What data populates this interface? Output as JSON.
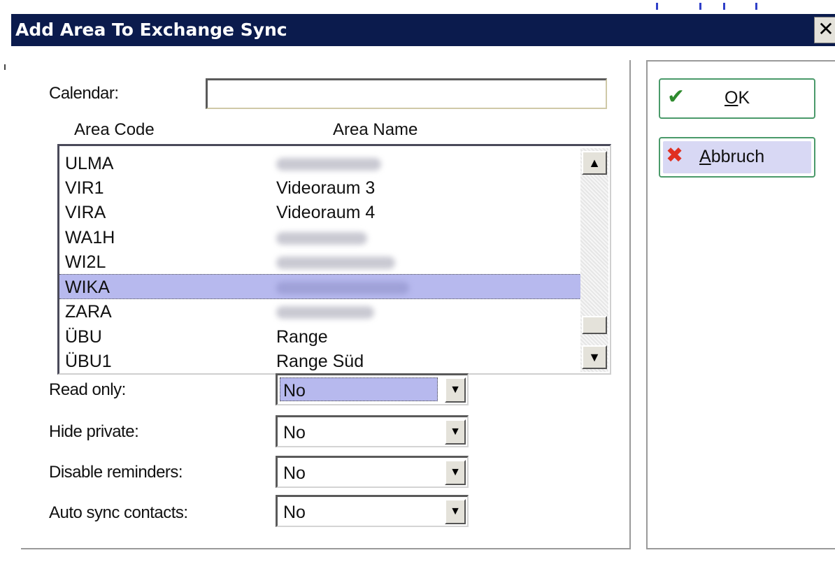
{
  "window": {
    "title": "Add Area To Exchange Sync",
    "close_glyph": "✕"
  },
  "form": {
    "calendar_label": "Calendar:",
    "calendar_value": "",
    "area_code_header": "Area Code",
    "area_name_header": "Area Name"
  },
  "areas": [
    {
      "code": "ULMA",
      "name": ""
    },
    {
      "code": "VIR1",
      "name": "Videoraum 3"
    },
    {
      "code": "VIRA",
      "name": "Videoraum 4"
    },
    {
      "code": "WA1H",
      "name": ""
    },
    {
      "code": "WI2L",
      "name": ""
    },
    {
      "code": "WIKA",
      "name": ""
    },
    {
      "code": "ZARA",
      "name": ""
    },
    {
      "code": "ÜBU",
      "name": "Range"
    },
    {
      "code": "ÜBU1",
      "name": "Range Süd"
    }
  ],
  "selected_area_index": 5,
  "options": {
    "read_only": {
      "label": "Read only:",
      "value": "No"
    },
    "hide_private": {
      "label": "Hide private:",
      "value": "No"
    },
    "disable_reminders": {
      "label": "Disable reminders:",
      "value": "No"
    },
    "auto_sync_contacts": {
      "label": "Auto sync contacts:",
      "value": "No"
    }
  },
  "buttons": {
    "ok": {
      "label_underlined": "O",
      "label_rest": "K",
      "icon": "checkmark-icon",
      "icon_color": "#2e8b2e"
    },
    "cancel": {
      "label_underlined": "A",
      "label_rest": "bbruch",
      "icon": "x-icon",
      "icon_color": "#e03020"
    }
  },
  "colors": {
    "titlebar": "#0b1b4d",
    "selection": "#b7b9ee",
    "button_border": "#4a9a6a"
  }
}
